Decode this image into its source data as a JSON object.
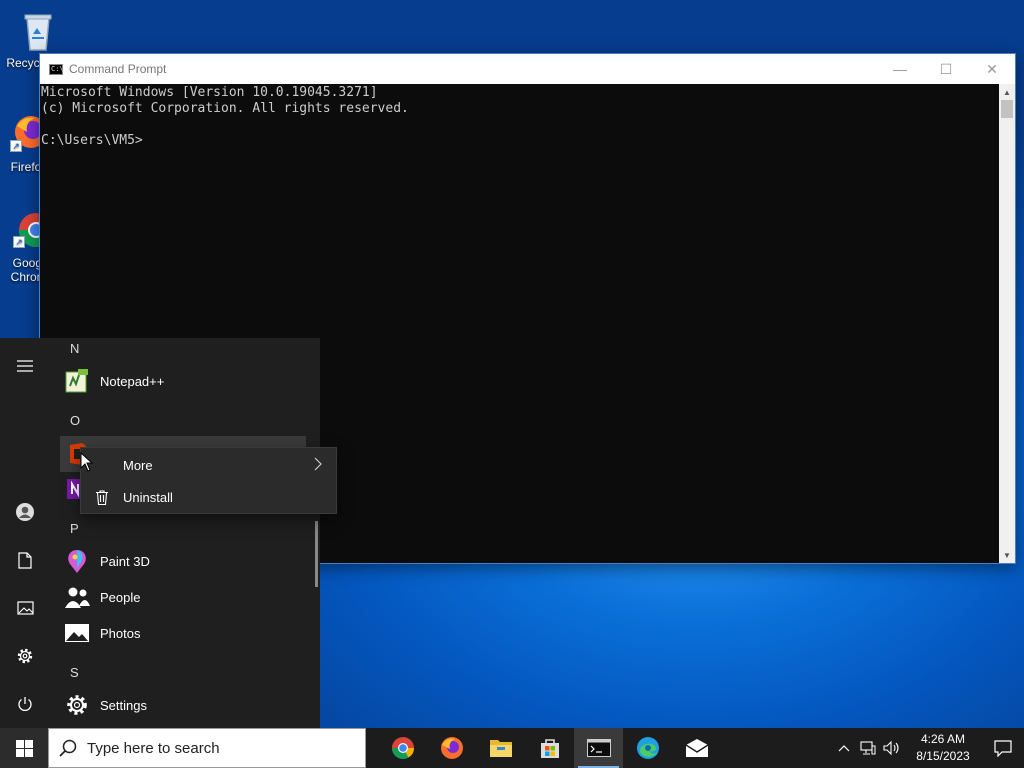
{
  "desktop": {
    "icons": [
      {
        "label": "Recycle Bin",
        "icon": "recycle-bin-icon"
      },
      {
        "label": "Firefox",
        "icon": "firefox-icon"
      },
      {
        "label": "Google Chrome",
        "icon": "chrome-icon"
      }
    ]
  },
  "cmd_window": {
    "title": "Command Prompt",
    "lines": [
      "Microsoft Windows [Version 10.0.19045.3271]",
      "(c) Microsoft Corporation. All rights reserved.",
      "",
      "C:\\Users\\VM5>"
    ]
  },
  "start_menu": {
    "groups": [
      {
        "letter": "N",
        "apps": [
          {
            "label": "Notepad++",
            "icon": "notepad-plus-plus-icon"
          }
        ]
      },
      {
        "letter": "O",
        "apps": [
          {
            "label": "",
            "icon": "office-icon"
          },
          {
            "label": "",
            "icon": "onenote-icon"
          }
        ]
      },
      {
        "letter": "P",
        "apps": [
          {
            "label": "Paint 3D",
            "icon": "paint-3d-icon"
          },
          {
            "label": "People",
            "icon": "people-icon"
          },
          {
            "label": "Photos",
            "icon": "photos-icon"
          }
        ]
      },
      {
        "letter": "S",
        "apps": [
          {
            "label": "Settings",
            "icon": "gear-icon"
          }
        ]
      }
    ],
    "rail": [
      "hamburger-menu-icon",
      "user-account-icon",
      "documents-icon",
      "pictures-icon",
      "settings-icon",
      "power-icon"
    ]
  },
  "context_menu": {
    "items": [
      {
        "label": "More",
        "icon": "",
        "submenu": true
      },
      {
        "label": "Uninstall",
        "icon": "trash-icon",
        "submenu": false
      }
    ]
  },
  "taskbar": {
    "search_placeholder": "Type here to search",
    "pinned": [
      "chrome-icon",
      "firefox-icon",
      "file-explorer-icon",
      "microsoft-store-icon",
      "command-prompt-icon",
      "edge-icon",
      "mail-icon"
    ],
    "active": "command-prompt-icon",
    "time": "4:26 AM",
    "date": "8/15/2023"
  },
  "colors": {
    "desktop_blue": "#0a6fd8",
    "menu_bg": "#1f1f1f",
    "taskbar_bg": "#1c1c1c",
    "console_bg": "#0c0c0c",
    "console_text": "#cccccc"
  }
}
